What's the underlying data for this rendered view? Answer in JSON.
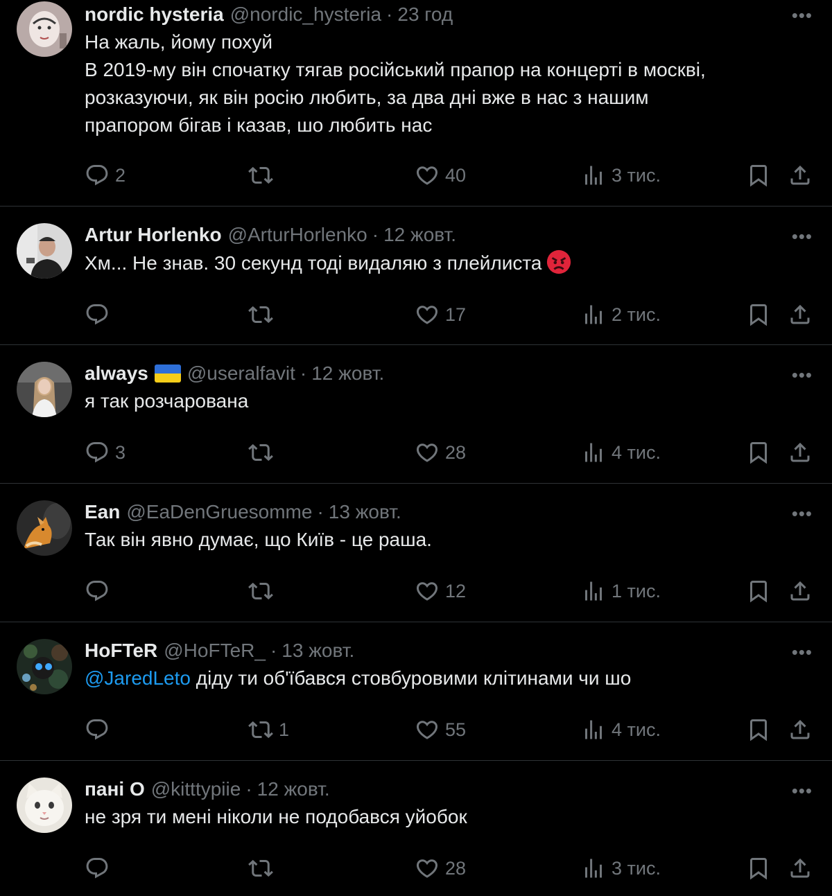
{
  "colors": {
    "background": "#000000",
    "text": "#e7e9ea",
    "muted": "#71767b",
    "mention": "#1d9bf0",
    "divider": "#2f3336"
  },
  "tweets": [
    {
      "name": "nordic hysteria",
      "handle": "@nordic_hysteria",
      "separator": "·",
      "time": "23 год",
      "lines": [
        "На жаль, йому похуй",
        "В 2019-му він спочатку тягав російський прапор на концерті в москві,",
        "розказуючи, як він росію любить, за два дні вже в нас з нашим",
        "прапором бігав і казав, шо любить нас"
      ],
      "replies": "2",
      "retweets": "",
      "likes": "40",
      "views": "3 тис."
    },
    {
      "name": "Artur Horlenko",
      "handle": "@ArturHorlenko",
      "separator": "·",
      "time": "12 жовт.",
      "text": "Хм... Не знав. 30 секунд тоді видаляю з плейлиста",
      "emoji": "angry-face-emoji",
      "replies": "",
      "retweets": "",
      "likes": "17",
      "views": "2 тис."
    },
    {
      "name": "always",
      "flag": "ukraine-flag-emoji",
      "handle": "@useralfavit",
      "separator": "·",
      "time": "12 жовт.",
      "text": "я так розчарована",
      "replies": "3",
      "retweets": "",
      "likes": "28",
      "views": "4 тис."
    },
    {
      "name": "Ean",
      "handle": "@EaDenGruesomme",
      "separator": "·",
      "time": "13 жовт.",
      "text": "Так він явно думає, що Київ - це раша.",
      "replies": "",
      "retweets": "",
      "likes": "12",
      "views": "1 тис."
    },
    {
      "name": "HoFTeR",
      "handle": "@HoFTeR_",
      "separator": "·",
      "time": "13 жовт.",
      "mention": "@JaredLeto",
      "text": " діду ти об'їбався стовбуровими клітинами чи шо",
      "replies": "",
      "retweets": "1",
      "likes": "55",
      "views": "4 тис."
    },
    {
      "name": "пані О",
      "handle": "@kitttypiie",
      "separator": "·",
      "time": "12 жовт.",
      "text": "не зря ти мені ніколи не подобався уйобок",
      "replies": "",
      "retweets": "",
      "likes": "28",
      "views": "3 тис."
    }
  ],
  "more_label": "•••"
}
